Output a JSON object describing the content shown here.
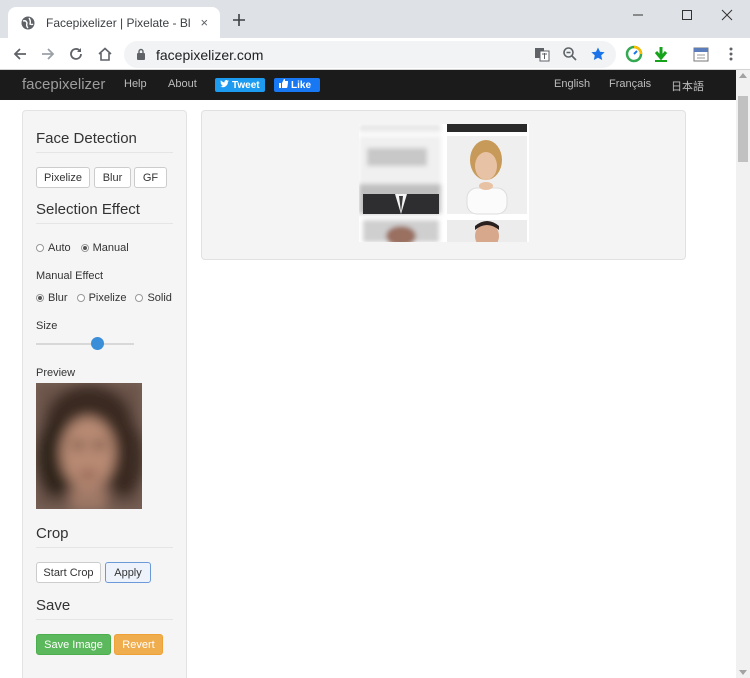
{
  "browser": {
    "tab_title": "Facepixelizer | Pixelate - Blur - Anonymize",
    "url": "facepixelizer.com",
    "new_tab": "+",
    "tab_close": "×"
  },
  "navbar": {
    "brand": "facepixelizer",
    "links": [
      "Help",
      "About"
    ],
    "tweet_label": "Tweet",
    "like_label": "Like",
    "languages": [
      "English",
      "Français",
      "日本語"
    ]
  },
  "sidebar": {
    "face_detection": {
      "title": "Face Detection",
      "buttons": [
        "Pixelize",
        "Blur",
        "GF"
      ]
    },
    "selection_effect": {
      "title": "Selection Effect",
      "options": [
        "Auto",
        "Manual"
      ],
      "selected": "Manual"
    },
    "manual_effect": {
      "label": "Manual Effect",
      "options": [
        "Blur",
        "Pixelize",
        "Solid"
      ],
      "selected": "Blur"
    },
    "size": {
      "label": "Size",
      "value_fraction": 0.63
    },
    "preview": {
      "label": "Preview"
    },
    "crop": {
      "title": "Crop",
      "start_label": "Start Crop",
      "apply_label": "Apply"
    },
    "save": {
      "title": "Save",
      "save_label": "Save Image",
      "revert_label": "Revert"
    }
  },
  "colors": {
    "navbar_bg": "#1b1b1b",
    "tweet": "#1d9bf0",
    "like": "#1877f2",
    "slider": "#3b8ed8",
    "save": "#5cb85c",
    "revert": "#f0ad4e"
  }
}
